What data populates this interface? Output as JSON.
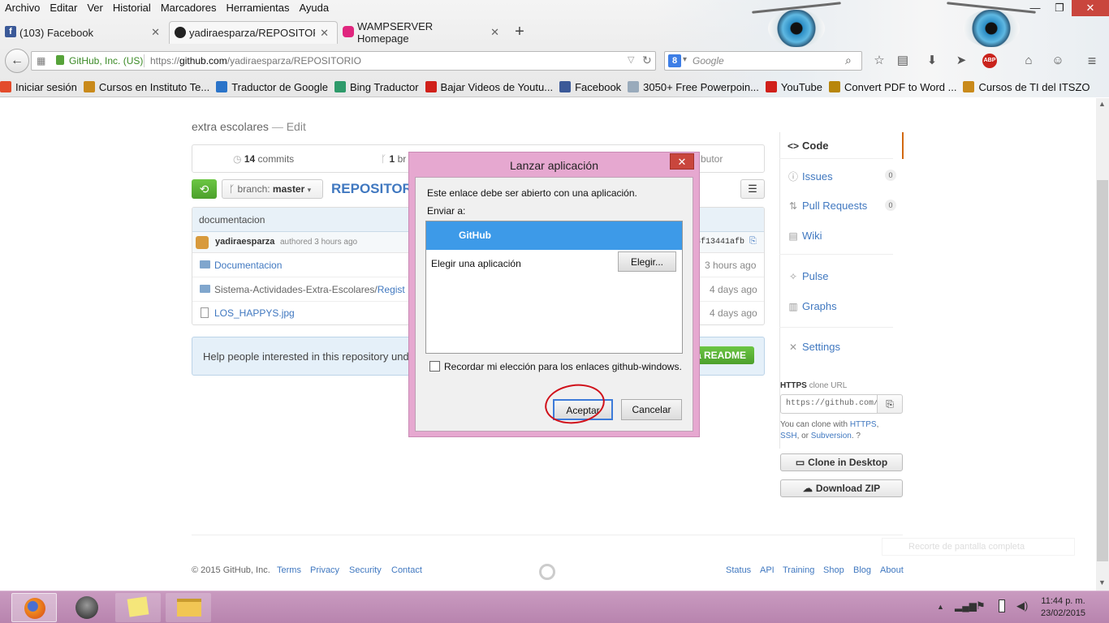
{
  "menubar": [
    "Archivo",
    "Editar",
    "Ver",
    "Historial",
    "Marcadores",
    "Herramientas",
    "Ayuda"
  ],
  "window_controls": {
    "minimize": "—",
    "maximize": "❐",
    "close": "✕"
  },
  "tabs": [
    {
      "title": "(103) Facebook",
      "icon": "facebook-icon",
      "color": "#3b5998"
    },
    {
      "title": "yadiraesparza/REPOSITORIO",
      "icon": "github-icon",
      "color": "#222",
      "active": true
    },
    {
      "title": "WAMPSERVER Homepage",
      "icon": "wampserver-icon",
      "color": "#e0267e"
    }
  ],
  "urlbar": {
    "identity": "GitHub, Inc. (US)",
    "url_prefix": "https://",
    "url_domain": "github.com",
    "url_path": "/yadiraesparza/REPOSITORIO"
  },
  "searchbar": {
    "placeholder": "Google",
    "engine_label": "8"
  },
  "bookmarks": [
    {
      "label": "Iniciar sesión",
      "icon": "windows-icon",
      "color": "#e34b2b"
    },
    {
      "label": "Cursos en Instituto Te...",
      "icon": "itszo-icon",
      "color": "#c98a1b"
    },
    {
      "label": "Traductor de Google",
      "icon": "translate-icon",
      "color": "#2b74c9"
    },
    {
      "label": "Bing Traductor",
      "icon": "bing-icon",
      "color": "#2e9a6a"
    },
    {
      "label": "Bajar Videos de Youtu...",
      "icon": "youtube-icon",
      "color": "#d0201a"
    },
    {
      "label": "Facebook",
      "icon": "facebook-icon",
      "color": "#3b5998"
    },
    {
      "label": "3050+ Free Powerpoin...",
      "icon": "page-icon",
      "color": "#9ab"
    },
    {
      "label": "YouTube",
      "icon": "youtube-icon",
      "color": "#d0201a"
    },
    {
      "label": "Convert PDF to Word ...",
      "icon": "pdf-icon",
      "color": "#b8860b"
    },
    {
      "label": "Cursos de TI del ITSZO",
      "icon": "itszo-icon",
      "color": "#c98a1b"
    }
  ],
  "repo": {
    "description": "extra escolares",
    "edit": "Edit",
    "commits_count": "14",
    "commits_label": "commits",
    "branches_count": "1",
    "branches_label": "br",
    "contributors_label": "butor",
    "branch_prefix": "branch:",
    "branch_name": "master",
    "repo_name": "REPOSITOR",
    "commit_message": "documentacion",
    "author": "yadiraesparza",
    "authored": "authored 3 hours ago",
    "sha": "3f13441afb",
    "files": [
      {
        "name": "Documentacion",
        "type": "folder",
        "age": "3 hours ago"
      },
      {
        "name": "Sistema-Actividades-Extra-Escolares/",
        "link": "Regist",
        "type": "folder",
        "age": "4 days ago"
      },
      {
        "name": "LOS_HAPPYS.jpg",
        "type": "file",
        "age": "4 days ago"
      }
    ],
    "readme_prompt": "Help people interested in this repository und",
    "readme_button": "a README"
  },
  "sidebar": {
    "items": [
      {
        "label": "Code",
        "icon": "code-icon"
      },
      {
        "label": "Issues",
        "icon": "issue-icon",
        "count": "0"
      },
      {
        "label": "Pull Requests",
        "icon": "pull-request-icon",
        "count": "0"
      },
      {
        "label": "Wiki",
        "icon": "wiki-icon"
      },
      {
        "label": "Pulse",
        "icon": "pulse-icon"
      },
      {
        "label": "Graphs",
        "icon": "graph-icon"
      },
      {
        "label": "Settings",
        "icon": "settings-icon"
      }
    ],
    "clone_protocol": "HTTPS",
    "clone_label": "clone URL",
    "clone_url": "https://github.com/ya",
    "clone_help_1": "You can clone with",
    "clone_https": "HTTPS",
    "clone_ssh": "SSH",
    "clone_or": ", or",
    "clone_svn": "Subversion",
    "clone_desktop": "Clone in Desktop",
    "download_zip": "Download ZIP"
  },
  "footer": {
    "copyright": "© 2015 GitHub, Inc.",
    "left_links": [
      "Terms",
      "Privacy",
      "Security",
      "Contact"
    ],
    "right_links": [
      "Status",
      "API",
      "Training",
      "Shop",
      "Blog",
      "About"
    ],
    "ghost_text": "Recorte de pantalla completa"
  },
  "dialog": {
    "title": "Lanzar aplicación",
    "message": "Este enlace debe ser abierto con una aplicación.",
    "send_to": "Enviar a:",
    "selected_app": "GitHub",
    "choose_app": "Elegir una aplicación",
    "choose_button": "Elegir...",
    "remember": "Recordar mi elección para los enlaces github-windows.",
    "accept": "Aceptar",
    "cancel": "Cancelar",
    "highlight_color": "#3d9ae8",
    "annotation_color": "#d0101a"
  },
  "taskbar": {
    "time": "11:44 p. m.",
    "date": "23/02/2015"
  }
}
